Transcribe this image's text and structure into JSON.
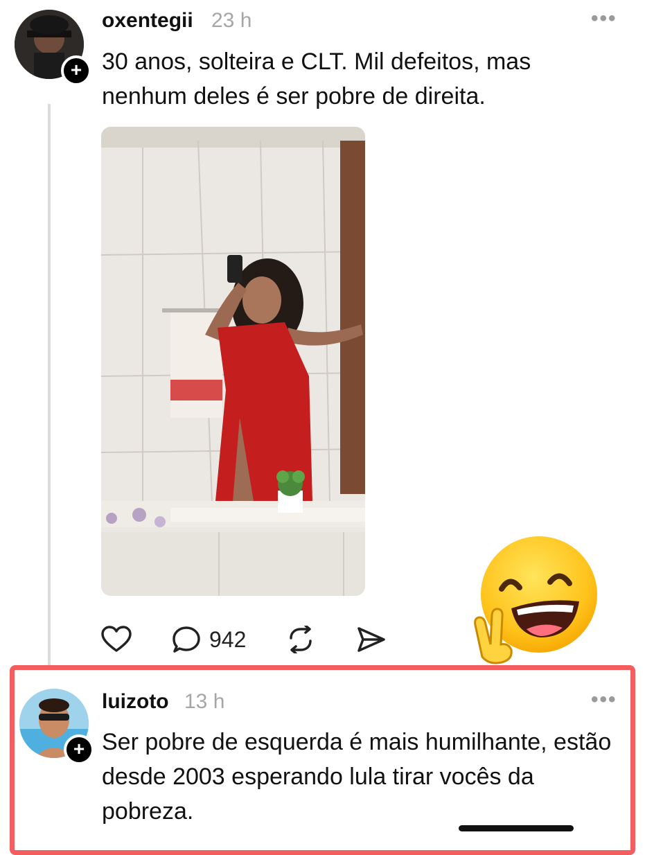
{
  "post": {
    "username": "oxentegii",
    "time": "23 h",
    "text": "30 anos, solteira e CLT. Mil defeitos, mas nenhum deles é ser pobre de direita.",
    "more_label": "•••",
    "follow_label": "+",
    "actions": {
      "like_icon": "heart-icon",
      "reply_icon": "speech-bubble-icon",
      "reply_count": "942",
      "repost_icon": "repost-icon",
      "share_icon": "send-icon"
    }
  },
  "reply": {
    "username": "luizoto",
    "time": "13 h",
    "text": "Ser pobre de esquerda é mais humilhante, estão desde 2003 esperando lula tirar vocês da pobreza.",
    "more_label": "•••",
    "follow_label": "+"
  },
  "overlay": {
    "emoji": "grinning-face-with-victory-hand",
    "highlight_color": "#f45d5d"
  }
}
